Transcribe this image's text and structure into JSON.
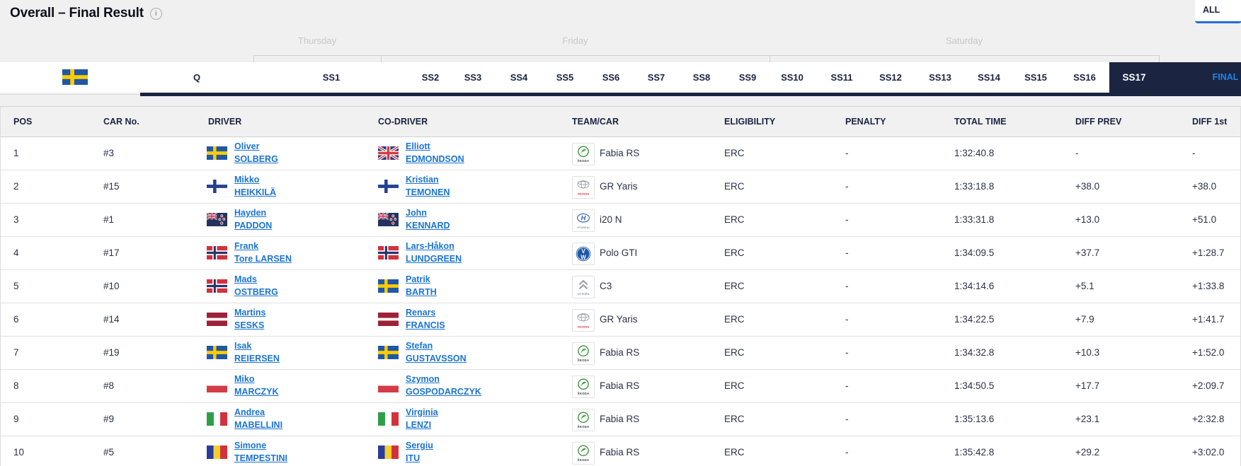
{
  "page": {
    "title": "Overall – Final Result",
    "info_icon": "i",
    "all_tab_label": "ALL"
  },
  "schedule": {
    "event_flag": "se",
    "days": [
      "Thursday",
      "Friday",
      "Saturday"
    ],
    "stages": [
      "Q",
      "SS1",
      "SS2",
      "SS3",
      "SS4",
      "SS5",
      "SS6",
      "SS7",
      "SS8",
      "SS9",
      "SS10",
      "SS11",
      "SS12",
      "SS13",
      "SS14",
      "SS15",
      "SS16"
    ],
    "active_stage": "SS17",
    "final_label": "FINAL"
  },
  "table": {
    "columns": [
      "POS",
      "CAR No.",
      "DRIVER",
      "CO-DRIVER",
      "TEAM/CAR",
      "ELIGIBILITY",
      "PENALTY",
      "TOTAL TIME",
      "DIFF PREV",
      "DIFF 1st"
    ],
    "rows": [
      {
        "pos": "1",
        "car_no": "#3",
        "driver": {
          "flag": "se",
          "line1": "Oliver",
          "line2": "SOLBERG"
        },
        "codriver": {
          "flag": "gb",
          "line1": "Elliott",
          "line2": "EDMONDSON"
        },
        "team": {
          "brand": "skoda",
          "car": "Fabia RS"
        },
        "eligibility": "ERC",
        "penalty": "-",
        "total_time": "1:32:40.8",
        "diff_prev": "-",
        "diff_first": "-"
      },
      {
        "pos": "2",
        "car_no": "#15",
        "driver": {
          "flag": "fi",
          "line1": "Mikko",
          "line2": "HEIKKILÄ"
        },
        "codriver": {
          "flag": "fi",
          "line1": "Kristian",
          "line2": "TEMONEN"
        },
        "team": {
          "brand": "toyota",
          "car": "GR Yaris"
        },
        "eligibility": "ERC",
        "penalty": "-",
        "total_time": "1:33:18.8",
        "diff_prev": "+38.0",
        "diff_first": "+38.0"
      },
      {
        "pos": "3",
        "car_no": "#1",
        "driver": {
          "flag": "nz",
          "line1": "Hayden",
          "line2": "PADDON"
        },
        "codriver": {
          "flag": "nz",
          "line1": "John",
          "line2": "KENNARD"
        },
        "team": {
          "brand": "hyundai",
          "car": "i20 N"
        },
        "eligibility": "ERC",
        "penalty": "-",
        "total_time": "1:33:31.8",
        "diff_prev": "+13.0",
        "diff_first": "+51.0"
      },
      {
        "pos": "4",
        "car_no": "#17",
        "driver": {
          "flag": "no",
          "line1": "Frank",
          "line2": "Tore LARSEN"
        },
        "codriver": {
          "flag": "no",
          "line1": "Lars-Håkon",
          "line2": "LUNDGREEN"
        },
        "team": {
          "brand": "vw",
          "car": "Polo GTI"
        },
        "eligibility": "ERC",
        "penalty": "-",
        "total_time": "1:34:09.5",
        "diff_prev": "+37.7",
        "diff_first": "+1:28.7"
      },
      {
        "pos": "5",
        "car_no": "#10",
        "driver": {
          "flag": "no",
          "line1": "Mads",
          "line2": "OSTBERG"
        },
        "codriver": {
          "flag": "se",
          "line1": "Patrik",
          "line2": "BARTH"
        },
        "team": {
          "brand": "citroen",
          "car": "C3"
        },
        "eligibility": "ERC",
        "penalty": "-",
        "total_time": "1:34:14.6",
        "diff_prev": "+5.1",
        "diff_first": "+1:33.8"
      },
      {
        "pos": "6",
        "car_no": "#14",
        "driver": {
          "flag": "lv",
          "line1": "Martins",
          "line2": "SESKS"
        },
        "codriver": {
          "flag": "lv",
          "line1": "Renars",
          "line2": "FRANCIS"
        },
        "team": {
          "brand": "toyota",
          "car": "GR Yaris"
        },
        "eligibility": "ERC",
        "penalty": "-",
        "total_time": "1:34:22.5",
        "diff_prev": "+7.9",
        "diff_first": "+1:41.7"
      },
      {
        "pos": "7",
        "car_no": "#19",
        "driver": {
          "flag": "se",
          "line1": "Isak",
          "line2": "REIERSEN"
        },
        "codriver": {
          "flag": "se",
          "line1": "Stefan",
          "line2": "GUSTAVSSON"
        },
        "team": {
          "brand": "skoda",
          "car": "Fabia RS"
        },
        "eligibility": "ERC",
        "penalty": "-",
        "total_time": "1:34:32.8",
        "diff_prev": "+10.3",
        "diff_first": "+1:52.0"
      },
      {
        "pos": "8",
        "car_no": "#8",
        "driver": {
          "flag": "pl",
          "line1": "Miko",
          "line2": "MARCZYK"
        },
        "codriver": {
          "flag": "pl",
          "line1": "Szymon",
          "line2": "GOSPODARCZYK"
        },
        "team": {
          "brand": "skoda",
          "car": "Fabia RS"
        },
        "eligibility": "ERC",
        "penalty": "-",
        "total_time": "1:34:50.5",
        "diff_prev": "+17.7",
        "diff_first": "+2:09.7"
      },
      {
        "pos": "9",
        "car_no": "#9",
        "driver": {
          "flag": "it",
          "line1": "Andrea",
          "line2": "MABELLINI"
        },
        "codriver": {
          "flag": "it",
          "line1": "Virginia",
          "line2": "LENZI"
        },
        "team": {
          "brand": "skoda",
          "car": "Fabia RS"
        },
        "eligibility": "ERC",
        "penalty": "-",
        "total_time": "1:35:13.6",
        "diff_prev": "+23.1",
        "diff_first": "+2:32.8"
      },
      {
        "pos": "10",
        "car_no": "#5",
        "driver": {
          "flag": "ro",
          "line1": "Simone",
          "line2": "TEMPESTINI"
        },
        "codriver": {
          "flag": "ro",
          "line1": "Sergiu",
          "line2": "ITU"
        },
        "team": {
          "brand": "skoda",
          "car": "Fabia RS"
        },
        "eligibility": "ERC",
        "penalty": "-",
        "total_time": "1:35:42.8",
        "diff_prev": "+29.2",
        "diff_first": "+3:02.0"
      }
    ]
  },
  "colors": {
    "accent_blue": "#1f6fd0",
    "dark_navy": "#1b2440",
    "link_blue": "#1b74d1",
    "final_blue": "#2086e8"
  }
}
